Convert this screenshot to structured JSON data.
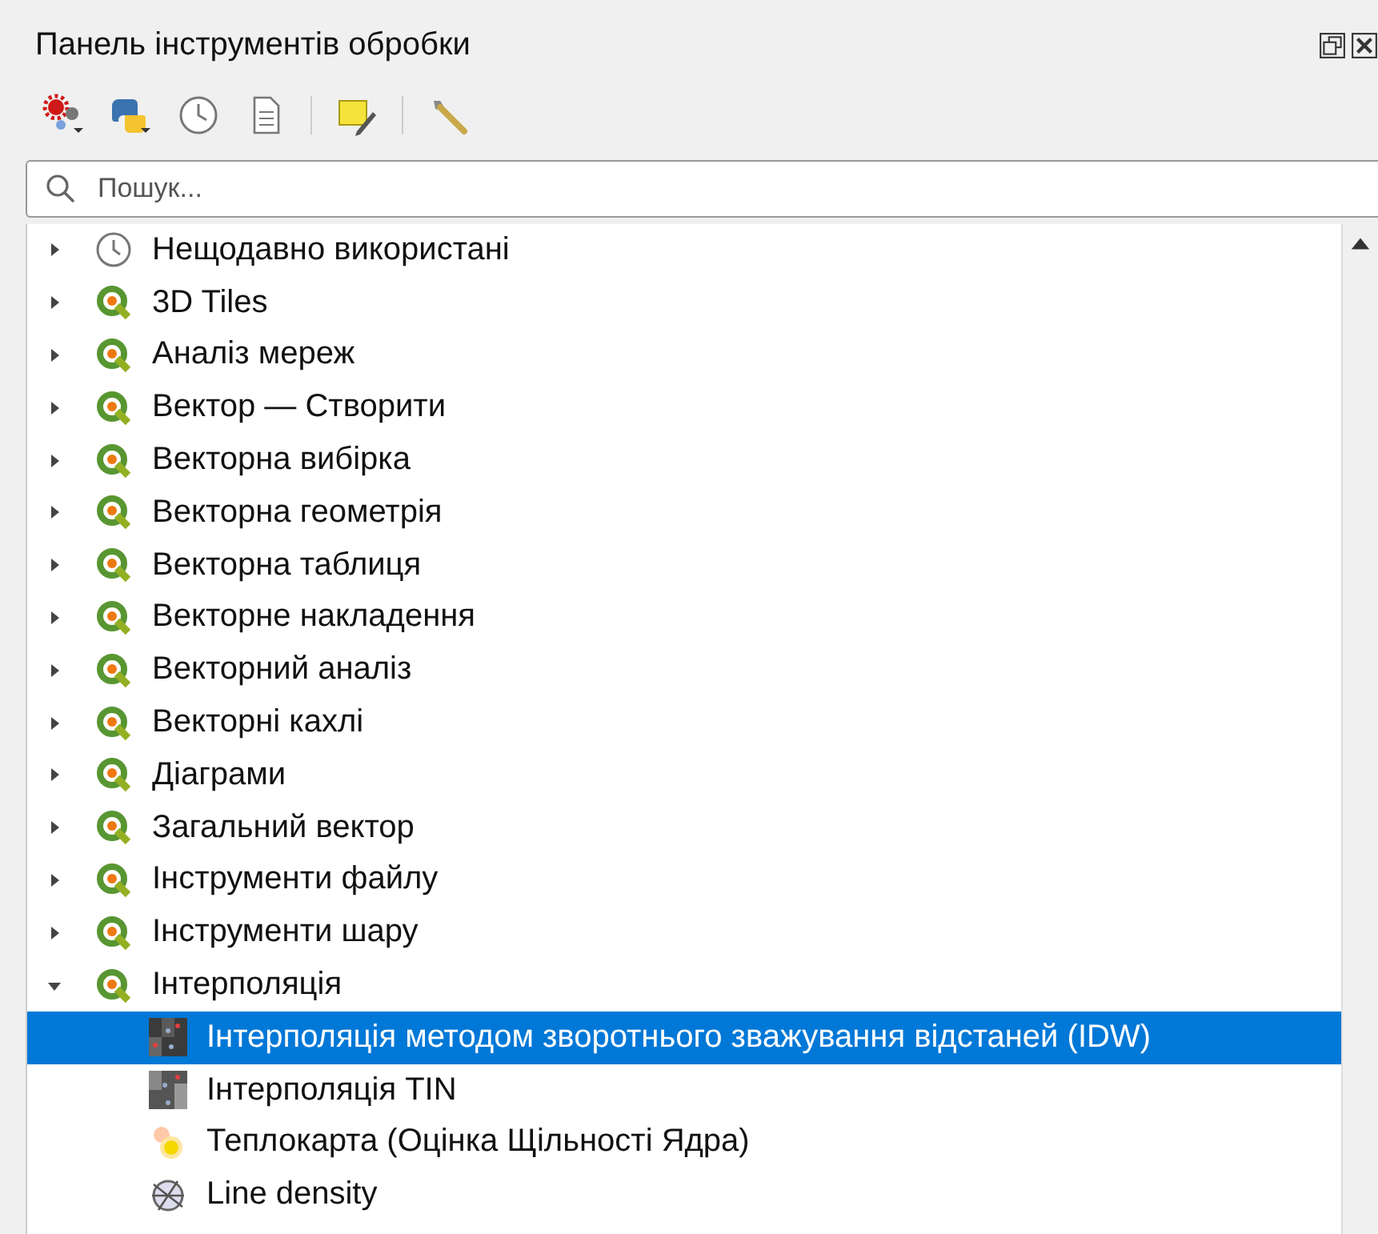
{
  "panel": {
    "title": "Панель інструментів обробки"
  },
  "search": {
    "placeholder": "Пошук..."
  },
  "tree": [
    {
      "label": "Нещодавно використані",
      "kind": "clock",
      "expanded": false,
      "selected": false
    },
    {
      "label": "3D Tiles",
      "kind": "qgis",
      "expanded": false,
      "selected": false
    },
    {
      "label": "Аналіз мереж",
      "kind": "qgis",
      "expanded": false,
      "selected": false
    },
    {
      "label": "Вектор — Створити",
      "kind": "qgis",
      "expanded": false,
      "selected": false
    },
    {
      "label": "Векторна вибірка",
      "kind": "qgis",
      "expanded": false,
      "selected": false
    },
    {
      "label": "Векторна геометрія",
      "kind": "qgis",
      "expanded": false,
      "selected": false
    },
    {
      "label": "Векторна таблиця",
      "kind": "qgis",
      "expanded": false,
      "selected": false
    },
    {
      "label": "Векторне накладення",
      "kind": "qgis",
      "expanded": false,
      "selected": false
    },
    {
      "label": "Векторний аналіз",
      "kind": "qgis",
      "expanded": false,
      "selected": false
    },
    {
      "label": "Векторні кахлі",
      "kind": "qgis",
      "expanded": false,
      "selected": false
    },
    {
      "label": "Діаграми",
      "kind": "qgis",
      "expanded": false,
      "selected": false
    },
    {
      "label": "Загальний вектор",
      "kind": "qgis",
      "expanded": false,
      "selected": false
    },
    {
      "label": "Інструменти файлу",
      "kind": "qgis",
      "expanded": false,
      "selected": false
    },
    {
      "label": "Інструменти шару",
      "kind": "qgis",
      "expanded": false,
      "selected": false
    },
    {
      "label": "Інтерполяція",
      "kind": "qgis",
      "expanded": true,
      "selected": false,
      "children": [
        {
          "label": "Інтерполяція методом зворотнього зважування відстаней (IDW)",
          "kind": "idw",
          "selected": true
        },
        {
          "label": "Інтерполяція TIN",
          "kind": "tin",
          "selected": false
        },
        {
          "label": "Теплокарта (Оцінка Щільності Ядра)",
          "kind": "heatmap",
          "selected": false
        },
        {
          "label": "Line density",
          "kind": "linedensity",
          "selected": false
        }
      ]
    }
  ]
}
